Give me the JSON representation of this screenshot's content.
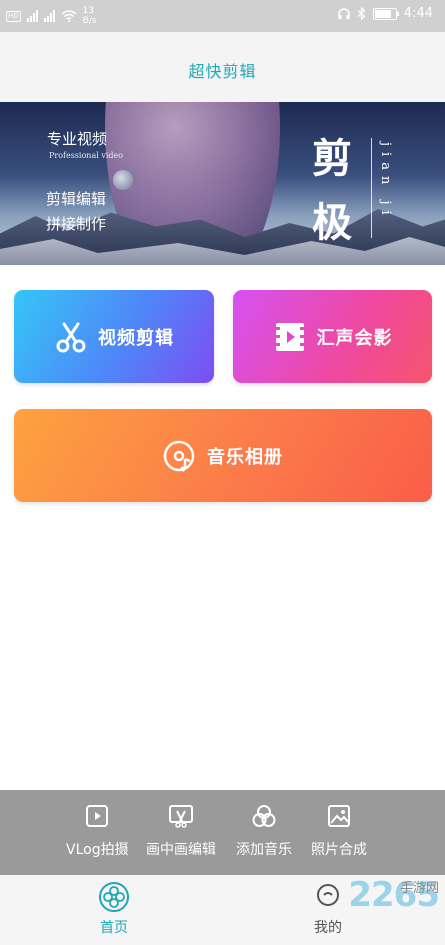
{
  "status_bar": {
    "net_speed": "13",
    "net_unit": "B/s",
    "time": "4:44",
    "battery_level": 0.8
  },
  "header": {
    "title": "超快剪辑"
  },
  "banner": {
    "line1": "专业视频",
    "line1_en": "Professional video",
    "line2": "剪辑编辑",
    "line3": "拼接制作",
    "big_char1": "剪",
    "big_char2": "极",
    "vertical_text": "jian ji"
  },
  "cards": {
    "video_edit": "视频剪辑",
    "audio_merge": "汇声会影",
    "music_album": "音乐相册"
  },
  "functions": {
    "vlog": "VLog拍摄",
    "pip": "画中画编辑",
    "add_music": "添加音乐",
    "photo_merge": "照片合成"
  },
  "tabs": {
    "home": "首页",
    "mine": "我的"
  },
  "watermark": {
    "brand": "2265",
    "site": "手游网"
  },
  "colors": {
    "accent": "#1fa7b6",
    "function_bar": "#9a9a9a"
  }
}
